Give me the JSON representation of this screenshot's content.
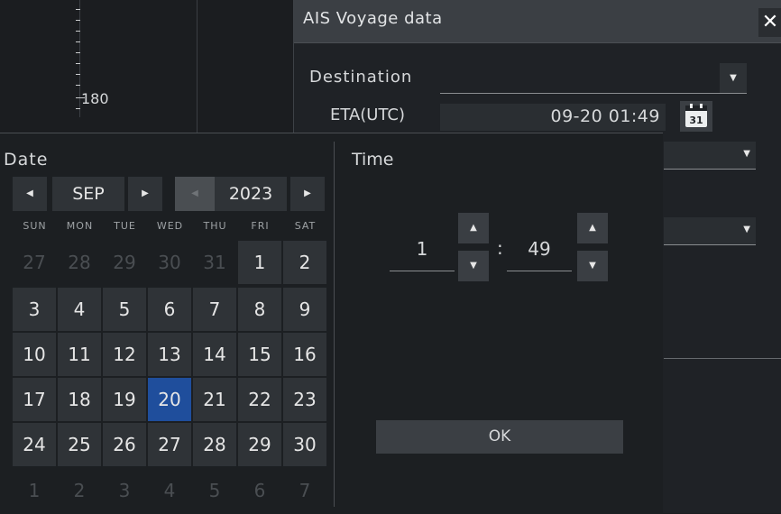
{
  "background": {
    "scale_label": "180"
  },
  "dialog": {
    "title": "AIS Voyage data",
    "close_label": "✕",
    "destination_label": "Destination",
    "destination_value": "",
    "eta_label": "ETA(UTC)",
    "eta_value": "09-20 01:49",
    "calendar_icon_label": "31"
  },
  "picker": {
    "date_heading": "Date",
    "time_heading": "Time",
    "month": "SEP",
    "year": "2023",
    "weekdays": [
      "SUN",
      "MON",
      "TUE",
      "WED",
      "THU",
      "FRI",
      "SAT"
    ],
    "weeks": [
      [
        "27",
        "28",
        "29",
        "30",
        "31",
        "1",
        "2"
      ],
      [
        "3",
        "4",
        "5",
        "6",
        "7",
        "8",
        "9"
      ],
      [
        "10",
        "11",
        "12",
        "13",
        "14",
        "15",
        "16"
      ],
      [
        "17",
        "18",
        "19",
        "20",
        "21",
        "22",
        "23"
      ],
      [
        "24",
        "25",
        "26",
        "27",
        "28",
        "29",
        "30"
      ],
      [
        "1",
        "2",
        "3",
        "4",
        "5",
        "6",
        "7"
      ]
    ],
    "selected_day": "20",
    "hour": "1",
    "minute": "49",
    "colon": ":",
    "ok_label": "OK"
  },
  "colors": {
    "selected_day": "#1f4e9c",
    "panel": "#1c1f22",
    "button": "#2f3337"
  },
  "icons": [
    "close-icon",
    "calendar-icon",
    "triangle-left-icon",
    "triangle-right-icon",
    "triangle-up-icon",
    "triangle-down-icon"
  ]
}
